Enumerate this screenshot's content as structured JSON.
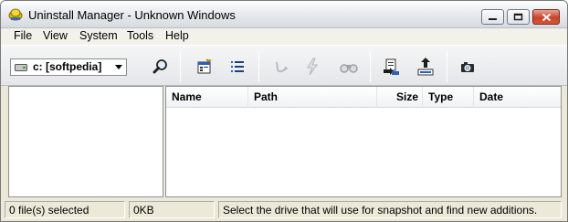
{
  "window": {
    "title": "Uninstall Manager - Unknown Windows"
  },
  "menu": {
    "items": [
      "File",
      "View",
      "System",
      "Tools",
      "Help"
    ]
  },
  "toolbar": {
    "drive": "c: [softpedia]",
    "buttons": [
      {
        "name": "find-icon"
      },
      {
        "name": "properties-icon"
      },
      {
        "name": "details-list-icon"
      },
      {
        "name": "uninstall-icon"
      },
      {
        "name": "snapshot-lightning-icon"
      },
      {
        "name": "binoculars-icon"
      },
      {
        "name": "import-icon"
      },
      {
        "name": "export-icon"
      },
      {
        "name": "camera-icon"
      }
    ]
  },
  "list": {
    "columns": [
      "Name",
      "Path",
      "Size",
      "Type",
      "Date"
    ]
  },
  "status": {
    "selected": "0 file(s) selected",
    "size": "0KB",
    "message": "Select the drive that will use for snapshot and find new additions."
  }
}
